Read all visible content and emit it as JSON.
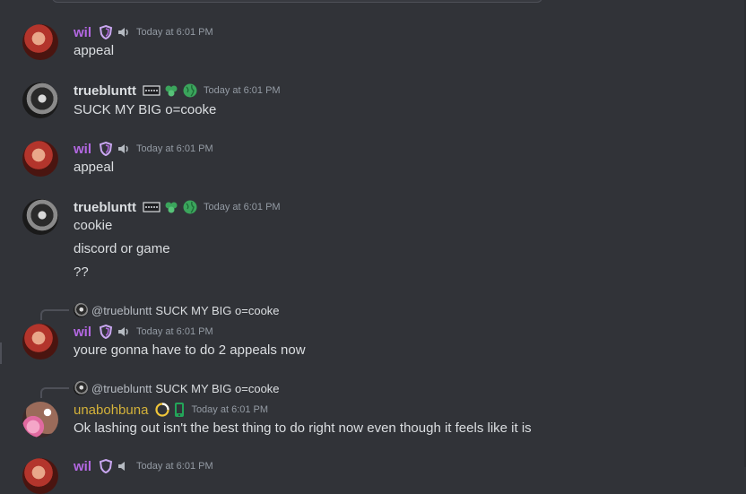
{
  "colors": {
    "background": "#313338",
    "text": "#dbdee1",
    "muted": "#949ba4",
    "wil": "#b468e3",
    "unabohbuna": "#d4b23a",
    "green_badge": "#3ba55c"
  },
  "messages": [
    {
      "author": "wil",
      "timestamp": "Today at 6:01 PM",
      "lines": [
        "appeal"
      ]
    },
    {
      "author": "truebluntt",
      "timestamp": "Today at 6:01 PM",
      "lines": [
        "SUCK MY BIG o=cooke"
      ]
    },
    {
      "author": "wil",
      "timestamp": "Today at 6:01 PM",
      "lines": [
        "appeal"
      ]
    },
    {
      "author": "truebluntt",
      "timestamp": "Today at 6:01 PM",
      "lines": [
        "cookie",
        "discord or game",
        "??"
      ]
    },
    {
      "author": "wil",
      "timestamp": "Today at 6:01 PM",
      "reply": {
        "name": "@truebluntt",
        "text": "SUCK MY BIG o=cooke"
      },
      "lines": [
        "youre gonna have to do 2 appeals now"
      ]
    },
    {
      "author": "unabohbuna",
      "timestamp": "Today at 6:01 PM",
      "reply": {
        "name": "@truebluntt",
        "text": "SUCK MY BIG o=cooke"
      },
      "lines": [
        "Ok lashing out isn't the best thing to do right now even though it feels like it is"
      ]
    },
    {
      "author": "wil",
      "timestamp": "Today at 6:01 PM",
      "lines": []
    }
  ],
  "icons": {
    "wil": [
      "shield-badge-icon",
      "speaker-icon"
    ],
    "truebluntt": [
      "flag-badge-icon",
      "leaf-badge-icon",
      "globe-icon"
    ],
    "unabohbuna": [
      "ring-badge-icon",
      "mobile-icon"
    ]
  }
}
